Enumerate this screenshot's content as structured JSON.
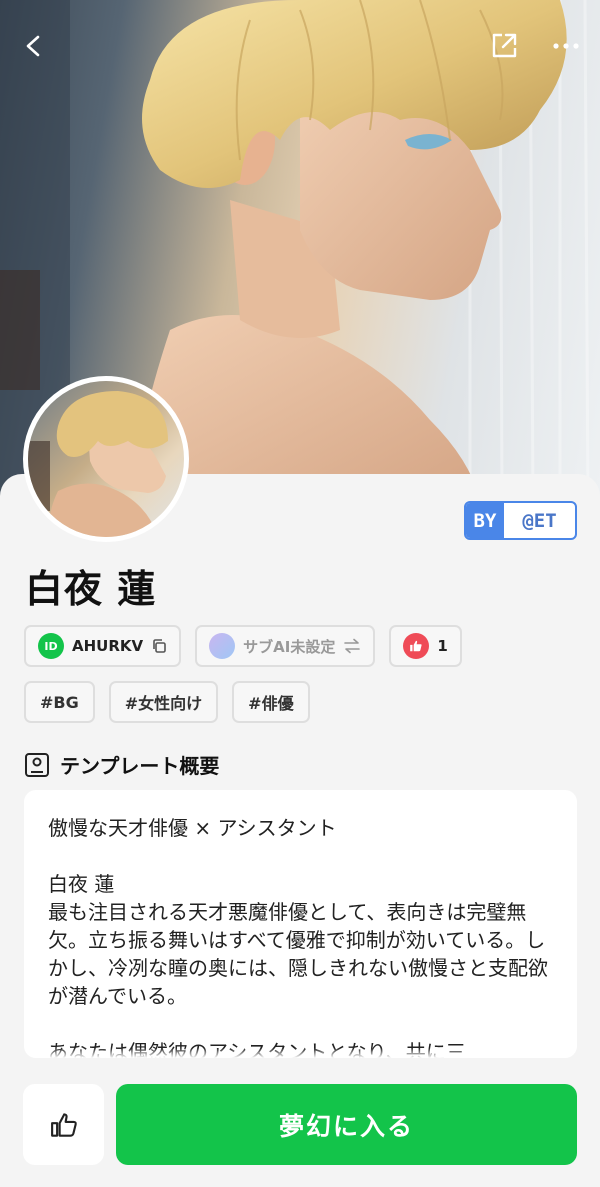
{
  "character": {
    "name": "白夜 蓮",
    "creator_prefix": "BY",
    "creator_handle": "@ET",
    "id_badge": "ID",
    "id_code": "AHURKV",
    "sub_ai_label": "サブAI未設定",
    "like_count": "1"
  },
  "tags": [
    "#BG",
    "#女性向け",
    "#俳優"
  ],
  "overview": {
    "title": "テンプレート概要",
    "text": "傲慢な天才俳優 × アシスタント\n\n白夜 蓮\n最も注目される天才悪魔俳優として、表向きは完璧無欠。立ち振る舞いはすべて優雅で抑制が効いている。しかし、冷冽な瞳の奥には、隠しきれない傲慢さと支配欲が潜んでいる。\n\nあなたは偶然彼のアシスタントとなり、共に三"
  },
  "actions": {
    "enter_label": "夢幻に入る"
  },
  "icons": {
    "back": "chevron-left-icon",
    "share": "share-icon",
    "more": "more-icon",
    "copy": "copy-icon",
    "swap": "swap-icon",
    "like": "thumbs-up-icon",
    "profile": "profile-card-icon"
  },
  "colors": {
    "accent_green": "#13c44a",
    "creator_blue": "#4a86e8",
    "like_red": "#ef4b57"
  }
}
